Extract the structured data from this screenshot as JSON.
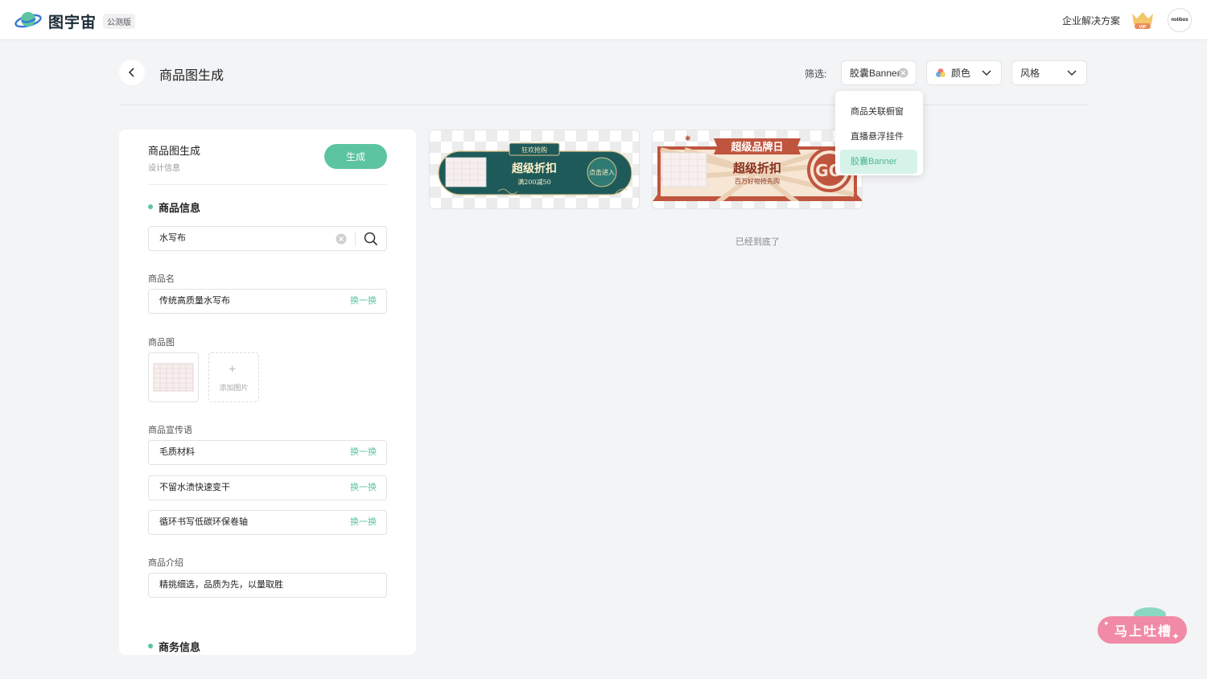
{
  "topbar": {
    "brand": "图宇宙",
    "badge": "公测版",
    "enterprise_link": "企业解决方案",
    "vip_label": "VIP",
    "avatar_text": "nolibox"
  },
  "header": {
    "title": "商品图生成",
    "filter_label": "筛选:",
    "filter_type": "胶囊Banner",
    "filter_color": "颜色",
    "filter_style": "风格"
  },
  "dropdown": {
    "items": [
      "商品关联橱窗",
      "直播悬浮挂件",
      "胶囊Banner"
    ],
    "selected": "胶囊Banner"
  },
  "panel": {
    "title": "商品图生成",
    "subtitle": "设计信息",
    "generate": "生成",
    "section_product": "商品信息",
    "search_value": "水写布",
    "name_label": "商品名",
    "name_value": "传统高质量水写布",
    "swap": "换一换",
    "image_label": "商品图",
    "add_image": "添加图片",
    "slogan_label": "商品宣传语",
    "slogans": [
      "毛质材料",
      "不留水渍快速变干",
      "循环书写低碳环保卷轴"
    ],
    "intro_label": "商品介绍",
    "intro_value": "精挑细选，品质为先，以量取胜",
    "section_business": "商务信息"
  },
  "results": {
    "card1": {
      "tag": "狂欢抢购",
      "headline": "超级折扣",
      "subline": "满200减50",
      "button": "点击进入"
    },
    "card2": {
      "tag": "超级品牌日",
      "headline": "超级折扣",
      "subline": "百万好物抢先购",
      "go": "GO"
    },
    "end_text": "已经到底了"
  },
  "feedback": {
    "label": "马上吐槽"
  },
  "colors": {
    "accent": "#5cc4a0",
    "card1_bg": "#1f5a5a",
    "card2_red": "#c0553f",
    "feedback": "#f08aa6"
  }
}
